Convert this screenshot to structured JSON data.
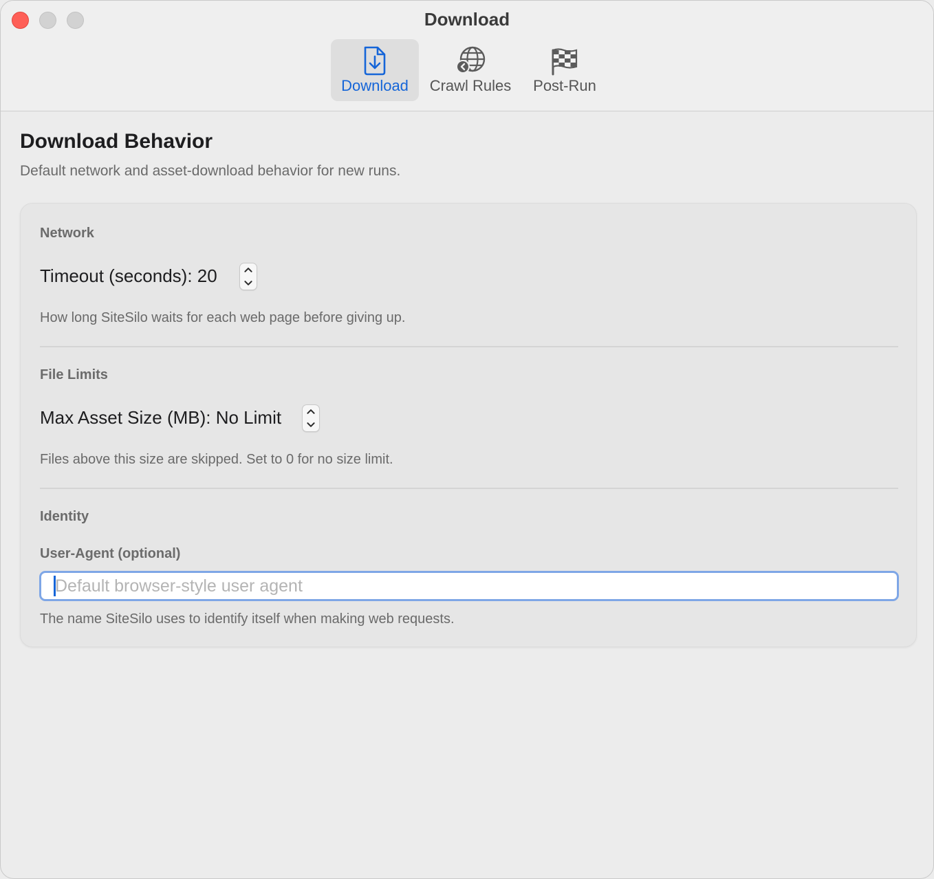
{
  "window": {
    "title": "Download"
  },
  "toolbar": {
    "tabs": [
      {
        "label": "Download",
        "icon": "arrow-down-doc-icon",
        "active": true
      },
      {
        "label": "Crawl Rules",
        "icon": "globe-back-icon",
        "active": false
      },
      {
        "label": "Post-Run",
        "icon": "flag-checkered-icon",
        "active": false
      }
    ]
  },
  "page": {
    "title": "Download Behavior",
    "subtitle": "Default network and asset-download behavior for new runs."
  },
  "sections": {
    "network": {
      "title": "Network",
      "timeout_label": "Timeout (seconds): 20",
      "timeout_value": 20,
      "help": "How long SiteSilo waits for each web page before giving up."
    },
    "file_limits": {
      "title": "File Limits",
      "max_asset_label": "Max Asset Size (MB): No Limit",
      "max_asset_value": "No Limit",
      "help": "Files above this size are skipped. Set to 0 for no size limit."
    },
    "identity": {
      "title": "Identity",
      "user_agent_label": "User-Agent (optional)",
      "user_agent_value": "",
      "user_agent_placeholder": "Default browser-style user agent",
      "help": "The name SiteSilo uses to identify itself when making web requests."
    }
  },
  "colors": {
    "accent": "#1565d8",
    "focus_ring": "#7ea6e6",
    "close": "#fe5f57",
    "inactive_traffic": "#d2d2d2"
  }
}
